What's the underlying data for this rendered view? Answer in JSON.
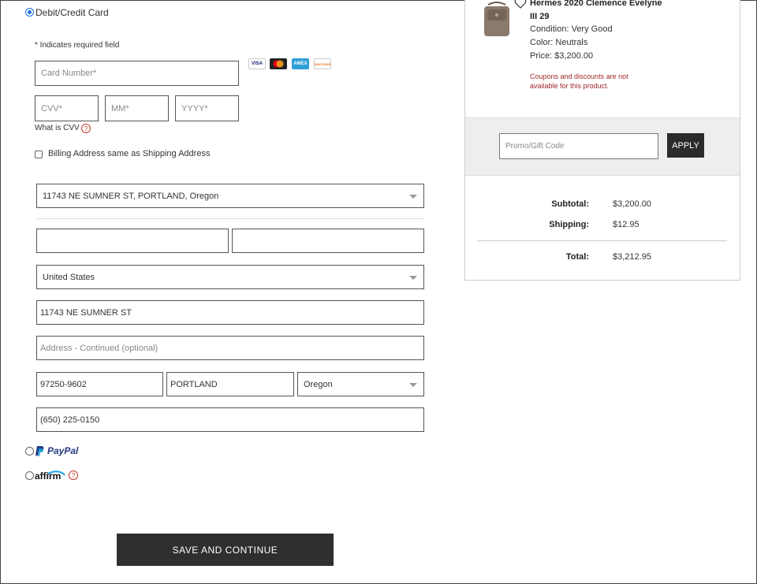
{
  "payment": {
    "card_option_label": "Debit/Credit Card",
    "required_note": "* Indicates required field",
    "card_number_placeholder": "Card Number*",
    "cvv_placeholder": "CVV*",
    "mm_placeholder": "MM*",
    "yyyy_placeholder": "YYYY*",
    "what_is_cvv": "What is CVV",
    "help_mark": "?",
    "card_brands": [
      "VISA",
      "MC",
      "AMEX",
      "DISCOVER"
    ],
    "paypal_label": "PayPal",
    "affirm_label": "affirm"
  },
  "billing": {
    "same_as_shipping_label": "Billing Address same as Shipping Address",
    "saved_address": "11743 NE SUMNER ST, PORTLAND, Oregon",
    "first_name": "",
    "last_name": "",
    "country": "United States",
    "address1": "11743 NE SUMNER ST",
    "address2_placeholder": "Address - Continued (optional)",
    "zip": "97250-9602",
    "city": "PORTLAND",
    "state": "Oregon",
    "phone": "(650) 225-0150"
  },
  "summary": {
    "product_title_line1": "Hermes 2020 Clemence Evelyne",
    "product_title_line2": "III 29",
    "condition": "Condition: Very Good",
    "color": "Color: Neutrals",
    "price": "Price: $3,200.00",
    "coupon_note_line1": "Coupons and discounts are not",
    "coupon_note_line2": "available for this product.",
    "promo_placeholder": "Promo/Gift Code",
    "apply_label": "APPLY",
    "subtotal_label": "Subtotal:",
    "subtotal_value": "$3,200.00",
    "shipping_label": "Shipping:",
    "shipping_value": "$12.95",
    "total_label": "Total:",
    "total_value": "$3,212.95"
  },
  "actions": {
    "save_continue_label": "SAVE AND CONTINUE"
  },
  "colors": {
    "accent": "#1a73e8",
    "button_dark": "#2f2f2f",
    "warning_text": "#a0282b",
    "paypal_dark": "#253b80",
    "paypal_light": "#179bd7"
  }
}
